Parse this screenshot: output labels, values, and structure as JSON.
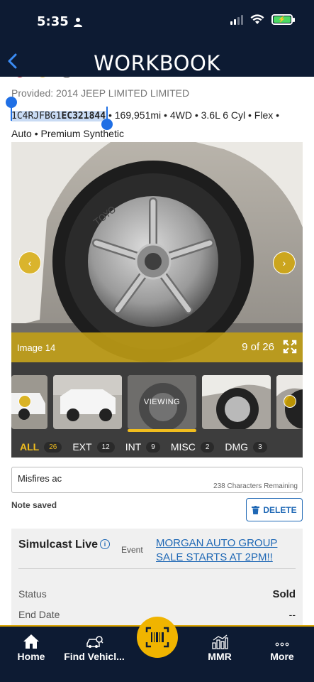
{
  "status_bar": {
    "time": "5:35"
  },
  "header": {
    "title": "WORKBOOK"
  },
  "vehicle": {
    "provided": "Provided: 2014 JEEP LIMITED LIMITED",
    "vin_prefix": "1C4RJFBG1",
    "vin_suffix": "EC321844",
    "details_line1": " • 169,951mi • 4WD • 3.6L 6 Cyl • Flex •",
    "details_line2": "Auto • Premium Synthetic"
  },
  "photo": {
    "caption": "Image 14",
    "counter": "9 of 26"
  },
  "thumbnails": {
    "viewing_label": "VIEWING"
  },
  "tabs": [
    {
      "label": "ALL",
      "count": "26",
      "active": true
    },
    {
      "label": "EXT",
      "count": "12"
    },
    {
      "label": "INT",
      "count": "9"
    },
    {
      "label": "MISC",
      "count": "2"
    },
    {
      "label": "DMG",
      "count": "3"
    }
  ],
  "note": {
    "value": "Misfires  ac",
    "remaining": "238 Characters Remaining",
    "saved_label": "Note saved",
    "delete_label": "DELETE"
  },
  "simulcast": {
    "title": "Simulcast Live",
    "event_label": "Event",
    "event_link": "MORGAN AUTO GROUP SALE STARTS AT 2PM!!",
    "rows": [
      {
        "label": "Status",
        "value": "Sold"
      },
      {
        "label": "End Date",
        "value": "--"
      }
    ]
  },
  "bottom_nav": {
    "home": "Home",
    "find": "Find Vehicl...",
    "mmr": "MMR",
    "more": "More"
  },
  "colors": {
    "navy": "#0d1b33",
    "accent_gold": "#f0b400",
    "link_blue": "#1f68b5",
    "ios_blue": "#3b8cf5"
  }
}
